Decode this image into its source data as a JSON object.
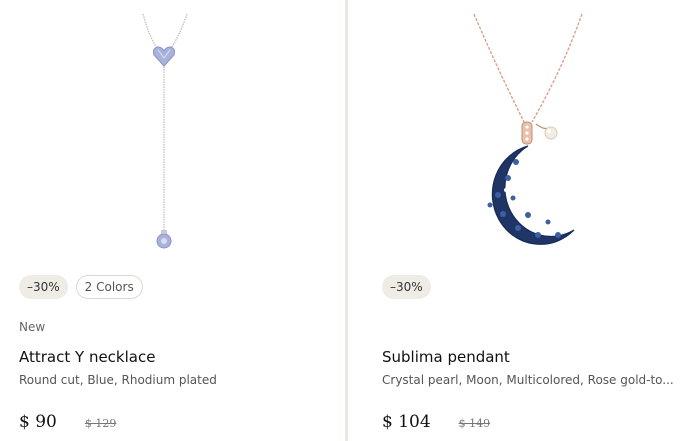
{
  "products": [
    {
      "discount_badge": "–30%",
      "colors_badge": "2 Colors",
      "tag": "New",
      "name": "Attract Y necklace",
      "description": "Round cut, Blue, Rhodium plated",
      "price": "$ 90",
      "old_price": "$ 129",
      "image_icon": "y-necklace-image"
    },
    {
      "discount_badge": "–30%",
      "name": "Sublima pendant",
      "description": "Crystal pearl, Moon, Multicolored, Rose gold-to...",
      "price": "$ 104",
      "old_price": "$ 149",
      "image_icon": "moon-pendant-image"
    }
  ],
  "colors": {
    "card_divider": "#ebe8e1",
    "badge_bg": "#eeece4",
    "chain_silver": "#b9bcc4",
    "crystal_blue": "#aab2dc",
    "chain_rose_gold": "#d9a488",
    "moon_blue": "#1f3566"
  }
}
